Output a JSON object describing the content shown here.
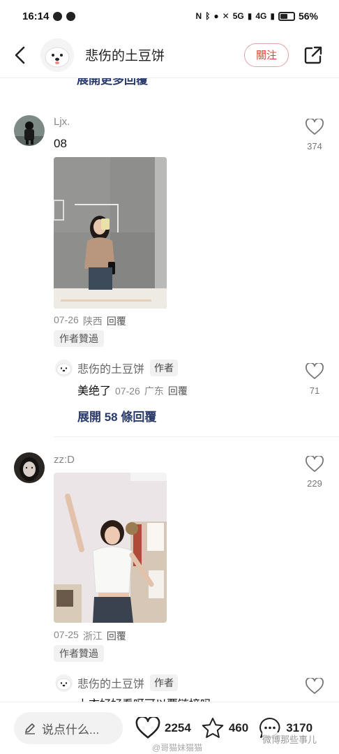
{
  "status_bar": {
    "time": "16:14",
    "signal1": "5G",
    "signal2": "4G",
    "battery": "56%",
    "battery_level": 0.56
  },
  "header": {
    "username": "悲伤的土豆饼",
    "follow_label": "關注"
  },
  "partial_top_text": "展開更多回覆",
  "comments": [
    {
      "user": "Ljx.",
      "text": "08",
      "date": "07-26",
      "location": "陕西",
      "reply_label": "回覆",
      "badge": "作者贊過",
      "likes": "374",
      "reply": {
        "user": "悲伤的土豆饼",
        "tag": "作者",
        "text": "美绝了",
        "date": "07-26",
        "location": "广东",
        "reply_label": "回覆",
        "likes": "71"
      },
      "expand_label": "展開 58 條回覆"
    },
    {
      "user": "zz:D",
      "date": "07-25",
      "location": "浙江",
      "reply_label": "回覆",
      "badge": "作者贊過",
      "likes": "229",
      "reply": {
        "user": "悲伤的土豆饼",
        "tag": "作者",
        "text": "上衣好好看呀可以要链接吗"
      }
    }
  ],
  "bottom_bar": {
    "input_placeholder": "说点什么...",
    "likes": "2254",
    "stars": "460",
    "comments": "3170"
  },
  "watermarks": {
    "left": "@哥猫妹猫猫",
    "right": "微博那些事儿"
  },
  "colors": {
    "accent_red": "#d4483b",
    "link_blue": "#2a3a6a",
    "meta_gray": "#888888"
  }
}
